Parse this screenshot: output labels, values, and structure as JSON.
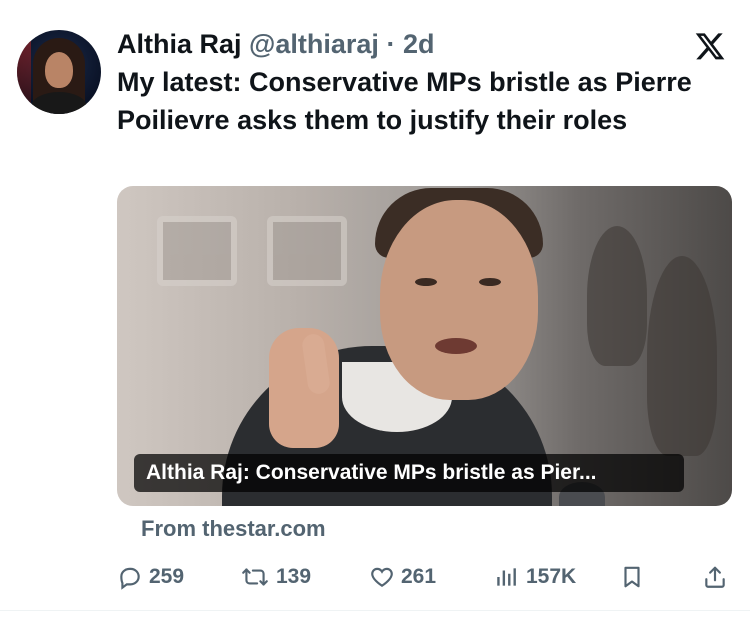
{
  "author": {
    "name": "Althia Raj",
    "handle": "@althiaraj",
    "separator": "·",
    "time": "2d"
  },
  "tweet": {
    "text": "My latest:  Conservative MPs bristle as Pierre Poilievre asks them to justify their roles"
  },
  "card": {
    "caption": "Althia Raj: Conservative MPs bristle as Pier...",
    "source": "From thestar.com"
  },
  "actions": {
    "replies": "259",
    "reposts": "139",
    "likes": "261",
    "views": "157K"
  },
  "icons": {
    "platform": "x-logo-icon",
    "reply": "reply-icon",
    "repost": "repost-icon",
    "like": "heart-icon",
    "views": "views-icon",
    "bookmark": "bookmark-icon",
    "share": "share-icon"
  },
  "colors": {
    "text": "#0f1419",
    "secondary": "#536471"
  }
}
